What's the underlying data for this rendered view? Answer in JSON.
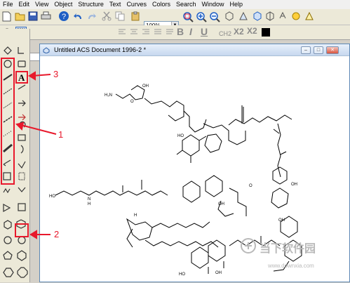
{
  "menu": [
    "File",
    "Edit",
    "View",
    "Object",
    "Structure",
    "Text",
    "Curves",
    "Colors",
    "Search",
    "Window",
    "Help"
  ],
  "toolbar": {
    "zoom_value": "100%"
  },
  "format_bar": {
    "bold": "B",
    "italic": "I",
    "underline": "U",
    "subscript_ch2": "CH2",
    "subscript": "X2",
    "superscript": "X2"
  },
  "document": {
    "title": "Untitled ACS Document 1996-2 *"
  },
  "palette": {
    "text_tool_label": "A"
  },
  "molecule_labels": {
    "nh2": "H₂N",
    "oh": "OH",
    "ho": "HO",
    "o": "O",
    "h": "H",
    "nh": "N",
    "nh_h": "H"
  },
  "annotations": {
    "callout_1": "1",
    "callout_2": "2",
    "callout_3": "3"
  },
  "watermark": {
    "brand": "当下软件园",
    "url": "www.downxia.com"
  },
  "colors": {
    "accent_red": "#e8192c",
    "window_border": "#5d88b5",
    "palette_bg": "#ece9d8"
  }
}
